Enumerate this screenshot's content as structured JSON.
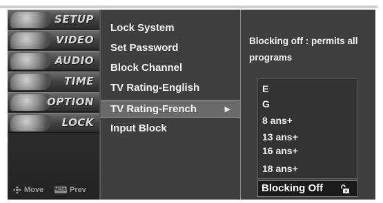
{
  "sidebar": {
    "items": [
      {
        "label": "SETUP",
        "icon": "setup-icon"
      },
      {
        "label": "VIDEO",
        "icon": "video-icon"
      },
      {
        "label": "AUDIO",
        "icon": "audio-icon"
      },
      {
        "label": "TIME",
        "icon": "time-icon"
      },
      {
        "label": "OPTION",
        "icon": "option-icon"
      },
      {
        "label": "LOCK",
        "icon": "lock-menu-icon"
      }
    ],
    "footer": {
      "move_label": "Move",
      "menu_key": "MENU",
      "prev_label": "Prev"
    }
  },
  "lock_menu": {
    "items": [
      {
        "label": "Lock System"
      },
      {
        "label": "Set Password"
      },
      {
        "label": "Block Channel"
      },
      {
        "label": "TV Rating-English"
      },
      {
        "label": "TV Rating-French",
        "selected": true,
        "arrow": "▶"
      },
      {
        "label": "Input Block"
      }
    ]
  },
  "detail": {
    "help_text": "Blocking off : permits all programs",
    "ratings": [
      "E",
      "G",
      "8 ans+",
      "13 ans+",
      "16 ans+",
      "18 ans+"
    ],
    "current_value": "Blocking Off",
    "current_icon": "unlocked-padlock-icon"
  },
  "colors": {
    "panel_bg": "#3f3f3f",
    "selected_bg": "#6a6a6a",
    "text": "#f2f2f2"
  }
}
